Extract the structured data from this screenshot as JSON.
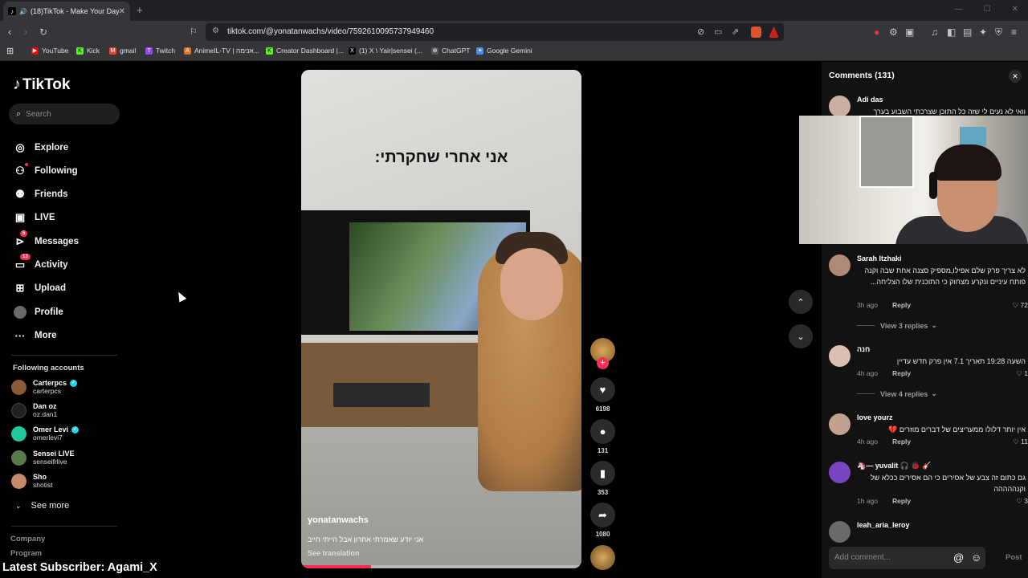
{
  "browser": {
    "tab_title": "(18)TikTok - Make Your Day",
    "new_tab": "+",
    "url": "tiktok.com/@yonatanwachs/video/7592610095737949460",
    "bookmarks": [
      {
        "label": "YouTube",
        "color": "#ff0000",
        "glyph": "▶"
      },
      {
        "label": "Kick",
        "color": "#53fc18",
        "glyph": "K"
      },
      {
        "label": "gmail",
        "color": "#ea4335",
        "glyph": "M"
      },
      {
        "label": "Twitch",
        "color": "#9146ff",
        "glyph": "T"
      },
      {
        "label": "AnimeIL-TV | אנימה...",
        "color": "#e0701f",
        "glyph": "A"
      },
      {
        "label": "Creator Dashboard |...",
        "color": "#53fc18",
        "glyph": "K"
      },
      {
        "label": "(1) X \\ Yair|sensei (...",
        "color": "#000000",
        "glyph": "X"
      },
      {
        "label": "ChatGPT",
        "color": "#555555",
        "glyph": "⊛"
      },
      {
        "label": "Google Gemini",
        "color": "#4e8cf5",
        "glyph": "✦"
      }
    ]
  },
  "tiktok": {
    "logo": "TikTok",
    "search_placeholder": "Search",
    "nav": [
      {
        "label": "Explore",
        "icon": "compass-icon",
        "glyph": "◎"
      },
      {
        "label": "Following",
        "icon": "following-icon",
        "glyph": "⚇"
      },
      {
        "label": "Friends",
        "icon": "friends-icon",
        "glyph": "⚉"
      },
      {
        "label": "LIVE",
        "icon": "live-icon",
        "glyph": "▣"
      },
      {
        "label": "Messages",
        "icon": "messages-icon",
        "glyph": "⊳",
        "badge": "5"
      },
      {
        "label": "Activity",
        "icon": "activity-icon",
        "glyph": "▭",
        "badge": "13"
      },
      {
        "label": "Upload",
        "icon": "upload-icon",
        "glyph": "⊞"
      },
      {
        "label": "Profile",
        "icon": "profile-icon",
        "glyph": "●"
      },
      {
        "label": "More",
        "icon": "more-icon",
        "glyph": "···"
      }
    ],
    "following_title": "Following accounts",
    "following": [
      {
        "name": "Carterpcs",
        "handle": "carterpcs",
        "verified": true,
        "color": "#8a5a3a"
      },
      {
        "name": "Dan oz",
        "handle": "oz.dan1",
        "verified": false,
        "color": "#222222"
      },
      {
        "name": "Omer Levi",
        "handle": "omerlevi7",
        "verified": true,
        "color": "#20c997"
      },
      {
        "name": "Sensei LIVE",
        "handle": "senseifrlive",
        "verified": false,
        "color": "#5a7a4a"
      },
      {
        "name": "Sho",
        "handle": "shotist",
        "verified": false,
        "color": "#c48a6a"
      }
    ],
    "see_more": "See more",
    "footer": [
      "Company",
      "Program"
    ],
    "overlay_subscriber": "Latest Subscriber: Agami_X"
  },
  "video": {
    "overlay_text": "אני אחרי שחקרתי:",
    "author": "yonatanwachs",
    "caption": "אני יודע שאמרתי אחרון אבל הייתי חייב",
    "see_translation": "See translation",
    "progress": 0.25,
    "likes": "6198",
    "comments": "131",
    "saves": "353",
    "shares": "1080"
  },
  "comments": {
    "title": "Comments (131)",
    "reply_label": "Reply",
    "add_placeholder": "Add comment...",
    "post_label": "Post",
    "items": [
      {
        "name": "Adi das",
        "text": "וואי לא נעים לי שזה כל התוכן שצרכתי השבוע בערך",
        "time": "",
        "likes": "",
        "color": "#c9b0a0"
      },
      {
        "name": "Sarah Itzhaki",
        "text": "לא צריך פרק שלם אפילו,מספיק סצנה אחת שבה וקנה פותח עיניים ונקרע מצחוק כי התוכנית שלו הצליחה...",
        "time": "3h ago",
        "likes": "72",
        "replies": "View 3 replies",
        "color": "#b08a78"
      },
      {
        "name": "חנה",
        "text": "השעה 19:28 תאריך 7.1 אין פרק חדש עדיין",
        "time": "4h ago",
        "likes": "1",
        "replies": "View 4 replies",
        "color": "#d9c0b0"
      },
      {
        "name": "love yourz",
        "text": "אין יותר דלולו ממעריצים של דברים מוזרים 💔",
        "time": "4h ago",
        "likes": "11",
        "color": "#c4a090"
      },
      {
        "name": "🦄— yuvalit 🎧 🐞 🎸",
        "text": "גם כתום זה צבע של אסירים כי הם אסירים ככלא של וקנההההה",
        "time": "1h ago",
        "likes": "3",
        "color": "#7a45c0"
      },
      {
        "name": "leah_aria_leroy",
        "text": "",
        "time": "",
        "likes": "",
        "color": "#6a6a6a"
      }
    ]
  }
}
